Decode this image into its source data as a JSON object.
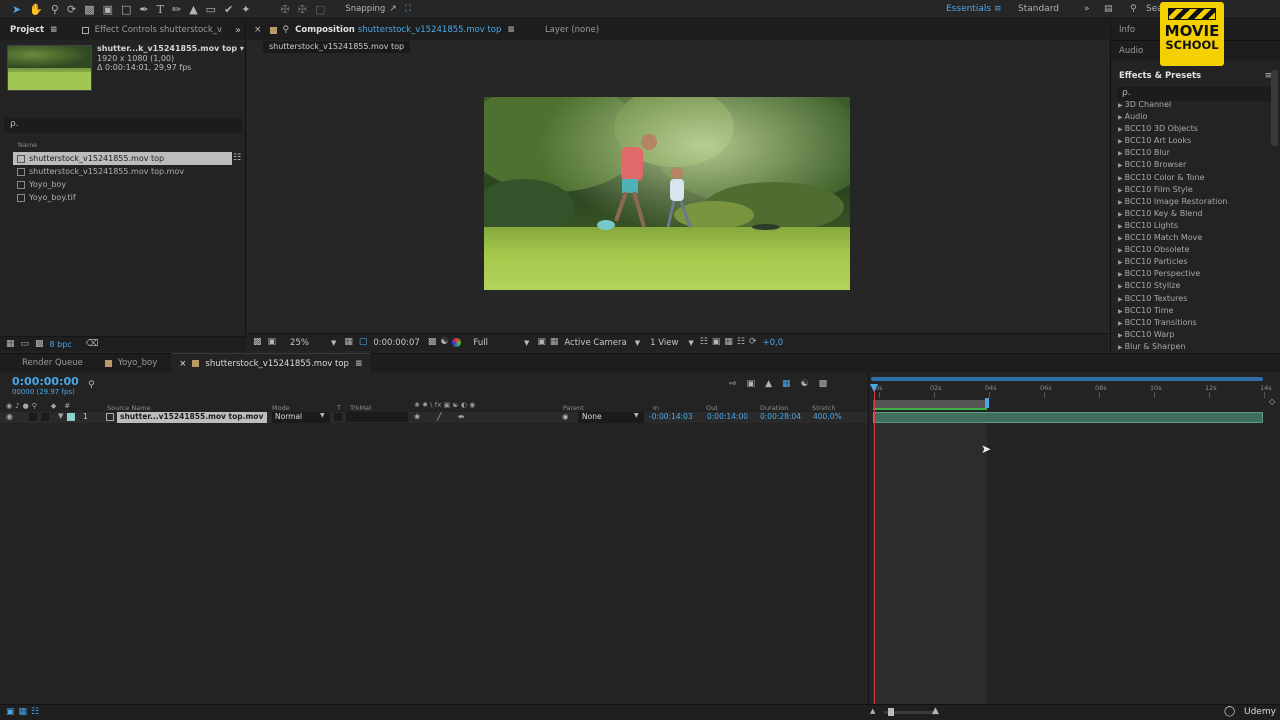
{
  "toolbar": {
    "snapping_label": "Snapping",
    "workspaces": [
      "Essentials",
      "Standard"
    ],
    "search_label": "Sea"
  },
  "project_panel": {
    "tabs": [
      "Project",
      "Effect Controls shutterstock_v"
    ],
    "selected_name": "shutter...k_v15241855.mov top ▾",
    "selected_resolution": "1920 x 1080 (1,00)",
    "selected_duration": "Δ 0:00:14:01, 29,97 fps",
    "search_icon_label": "ρ.",
    "column_name": "Name",
    "items": [
      "shutterstock_v15241855.mov top",
      "shutterstock_v15241855.mov top.mov",
      "Yoyo_boy",
      "Yoyo_boy.tif"
    ],
    "bpc_label": "8 bpc"
  },
  "comp_panel": {
    "tab_prefix": "Composition",
    "tab_name": "shutterstock_v15241855.mov top",
    "layer_tab": "Layer (none)",
    "breadcrumb": "shutterstock_v15241855.mov top",
    "zoom": "25%",
    "timecode": "0:00:00:07",
    "resolution": "Full",
    "camera": "Active Camera",
    "views": "1 View",
    "exposure": "+0,0"
  },
  "right_panel": {
    "info_label": "Info",
    "audio_label": "Audio",
    "effects_title": "Effects & Presets",
    "search_icon_label": "ρ.",
    "effects": [
      "3D Channel",
      "Audio",
      "BCC10 3D Objects",
      "BCC10 Art Looks",
      "BCC10 Blur",
      "BCC10 Browser",
      "BCC10 Color & Tone",
      "BCC10 Film Style",
      "BCC10 Image Restoration",
      "BCC10 Key & Blend",
      "BCC10 Lights",
      "BCC10 Match Move",
      "BCC10 Obsolete",
      "BCC10 Particles",
      "BCC10 Perspective",
      "BCC10 Stylize",
      "BCC10 Textures",
      "BCC10 Time",
      "BCC10 Transitions",
      "BCC10 Warp",
      "Blur & Sharpen"
    ]
  },
  "timeline": {
    "tabs": [
      "Render Queue",
      "Yoyo_boy",
      "shutterstock_v15241855.mov top"
    ],
    "current_time": "0:00:00:00",
    "frame_info": "00000 (29.97 fps)",
    "columns": {
      "source_name": "Source Name",
      "mode": "Mode",
      "t": "T",
      "trkmat": "TrkMat",
      "parent": "Parent",
      "in": "In",
      "out": "Out",
      "duration": "Duration",
      "stretch": "Stretch"
    },
    "layer": {
      "index": "1",
      "name": "shutter...v15241855.mov top.mov",
      "mode": "Normal",
      "parent": "None",
      "in": "-0:00:14:03",
      "out": "0:00:14:00",
      "duration": "0:00:28:04",
      "stretch": "400,0%"
    },
    "ruler": [
      "0s",
      "02s",
      "04s",
      "06s",
      "08s",
      "10s",
      "12s",
      "14s"
    ]
  },
  "logo": {
    "line1": "MOVIE",
    "line2": "SCHOOL"
  },
  "watermark": "Udemy"
}
